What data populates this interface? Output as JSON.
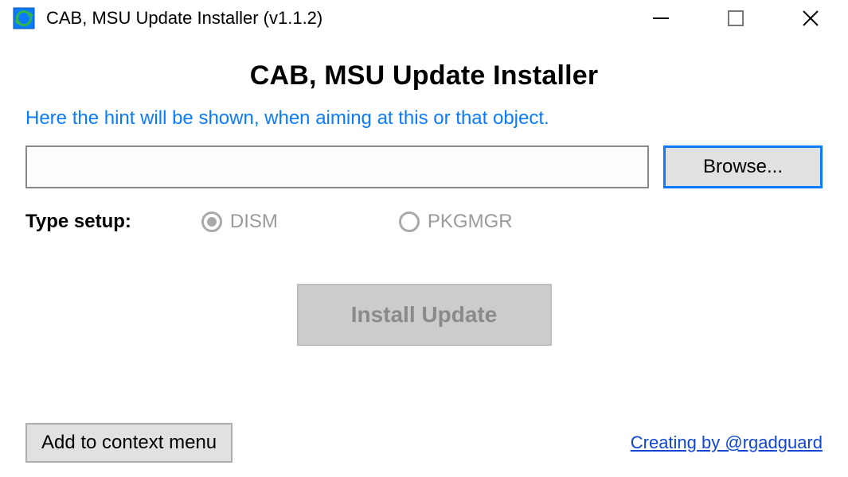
{
  "titlebar": {
    "title": "CAB, MSU Update Installer (v1.1.2)"
  },
  "heading": "CAB, MSU Update Installer",
  "hint": "Here the hint will be shown, when aiming at this or that object.",
  "file": {
    "value": "",
    "browse_label": "Browse..."
  },
  "type_setup": {
    "label": "Type setup:",
    "option1": "DISM",
    "option2": "PKGMGR",
    "selected": "DISM"
  },
  "install_label": "Install Update",
  "context_menu_label": "Add to context menu",
  "credit": "Creating by @rgadguard"
}
